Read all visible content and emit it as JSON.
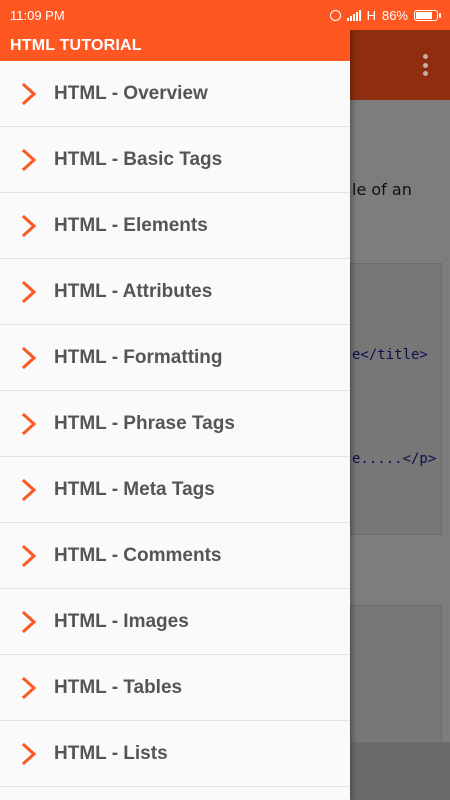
{
  "status_bar": {
    "time": "11:09 PM",
    "network": "H",
    "battery_percent": "86%",
    "battery_level": 0.86
  },
  "drawer": {
    "title": "HTML TUTORIAL",
    "accent_color": "#ff5722",
    "items": [
      {
        "label": "HTML - Overview"
      },
      {
        "label": "HTML - Basic Tags"
      },
      {
        "label": "HTML - Elements"
      },
      {
        "label": "HTML - Attributes"
      },
      {
        "label": "HTML - Formatting"
      },
      {
        "label": "HTML - Phrase Tags"
      },
      {
        "label": "HTML - Meta Tags"
      },
      {
        "label": "HTML - Comments"
      },
      {
        "label": "HTML - Images"
      },
      {
        "label": "HTML - Tables"
      },
      {
        "label": "HTML - Lists"
      }
    ]
  },
  "background": {
    "visible_text": "le of an",
    "code_line_1": "e</title>",
    "code_line_2": "e.....</p>"
  }
}
